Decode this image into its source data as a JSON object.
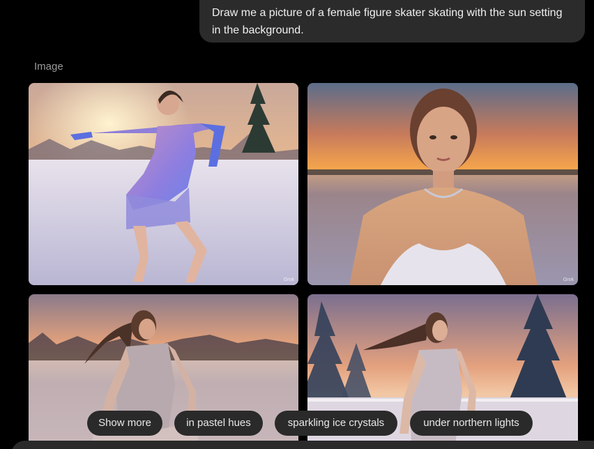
{
  "chat": {
    "user_message": "Draw me a picture of a female figure skater skating with the sun setting in the background."
  },
  "images_section": {
    "label": "Image",
    "images": [
      {
        "name": "figure skater in purple dress on ice at sunset",
        "watermark": "Grok"
      },
      {
        "name": "close-up portrait of skater with sunset",
        "watermark": "Grok"
      },
      {
        "name": "skater in silver dress with flowing hair at sunset",
        "watermark": ""
      },
      {
        "name": "skater in silver dress beside snowy pines",
        "watermark": ""
      }
    ]
  },
  "suggestions": {
    "chips": [
      "Show more",
      "in pastel hues",
      "sparkling ice crystals",
      "under northern lights"
    ]
  },
  "colors": {
    "background": "#000000",
    "bubble": "#2b2b2b",
    "chip": "#2a2a2a",
    "muted_text": "#9a9a9a"
  }
}
